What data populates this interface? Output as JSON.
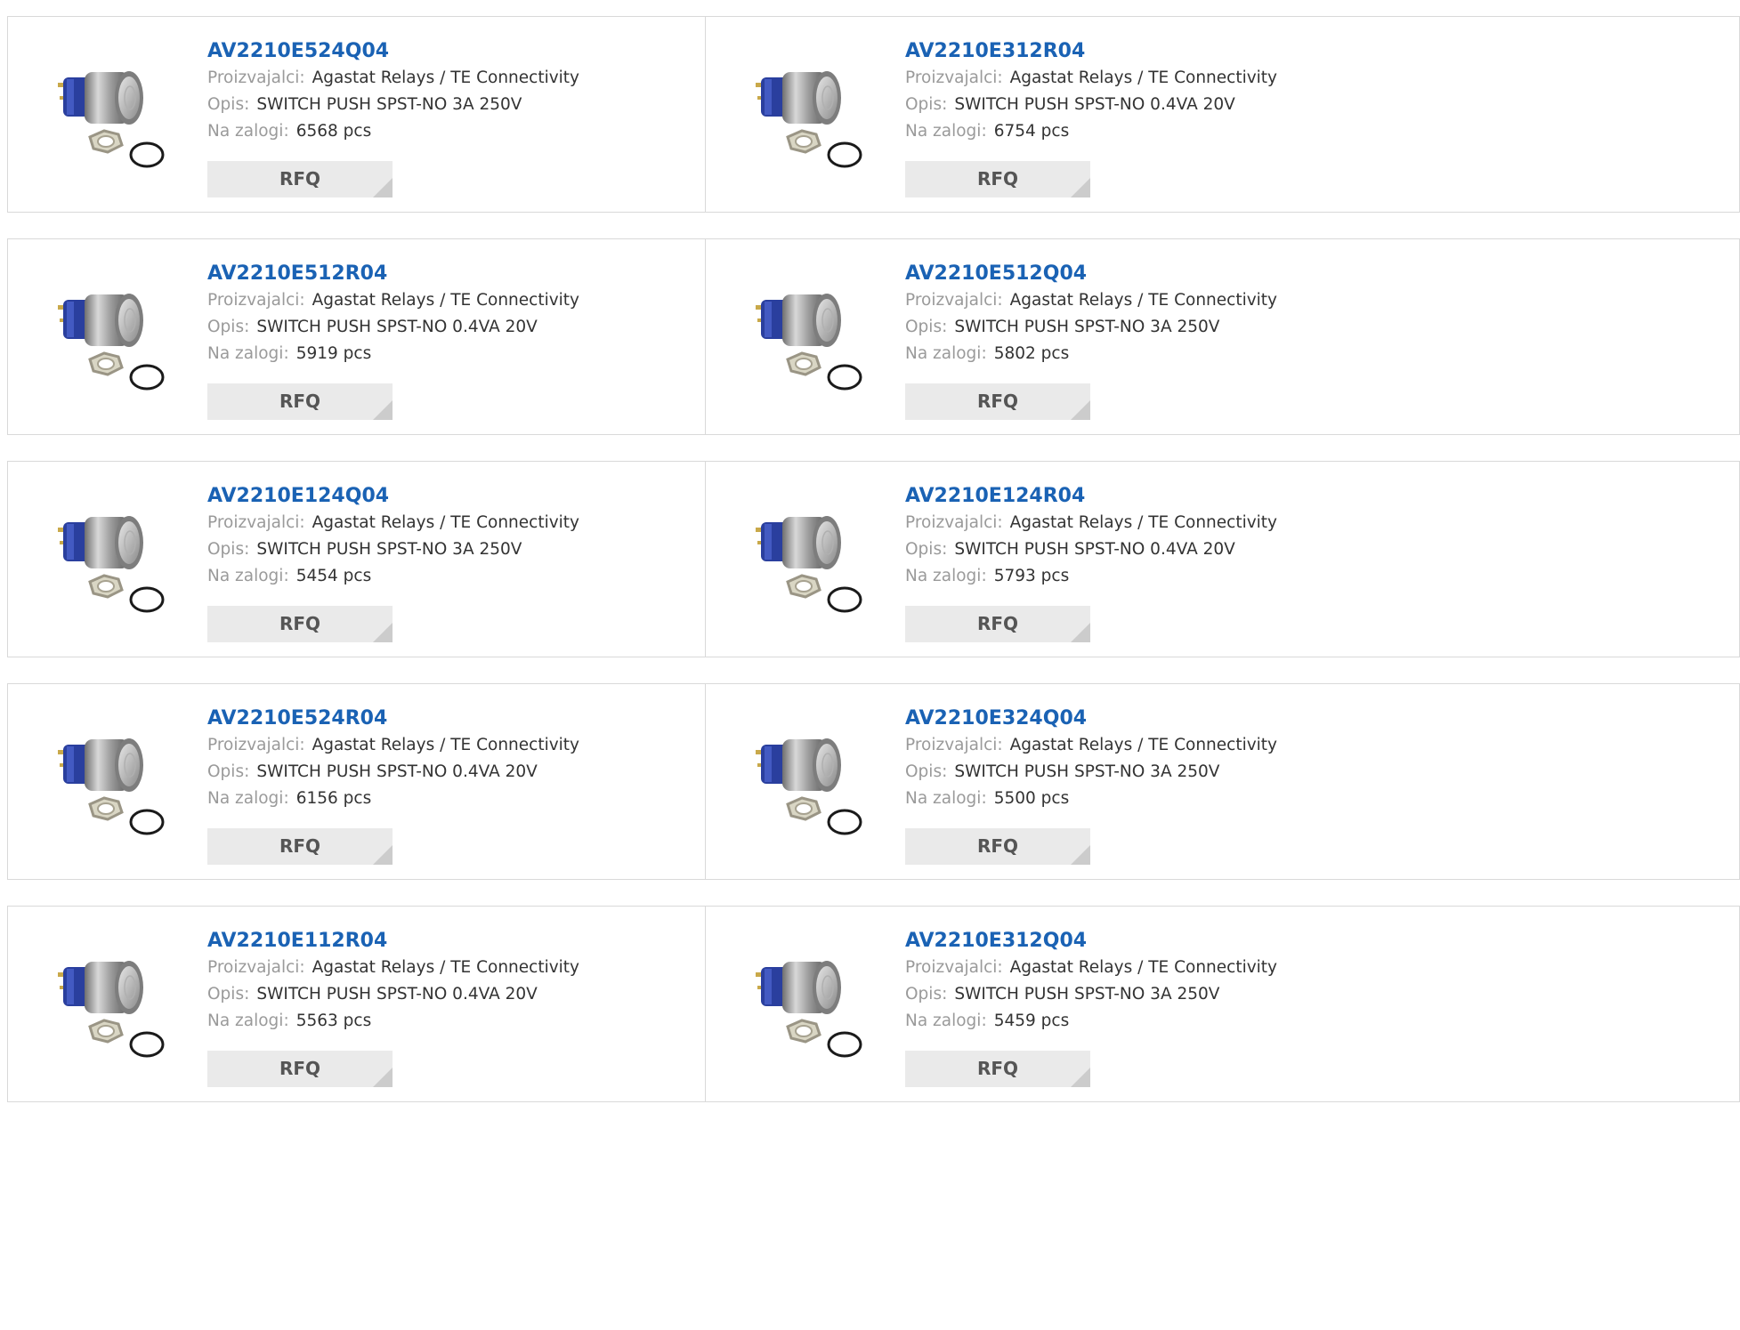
{
  "labels": {
    "manufacturer": "Proizvajalci:",
    "description": "Opis:",
    "stock": "Na zalogi:",
    "rfq_button": "RFQ"
  },
  "colors": {
    "part_link": "#1a62b4",
    "label_gray": "#9a9a9a",
    "value_text": "#333333",
    "button_bg": "#eaeaea",
    "button_text": "#555555",
    "border": "#d9d9d9"
  },
  "image_icon": "push-button-switch-photo",
  "products": [
    {
      "part": "AV2210E524Q04",
      "manufacturer": "Agastat Relays / TE Connectivity",
      "description": "SWITCH PUSH SPST-NO 3A 250V",
      "stock": "6568 pcs",
      "rfq": "RFQ"
    },
    {
      "part": "AV2210E312R04",
      "manufacturer": "Agastat Relays / TE Connectivity",
      "description": "SWITCH PUSH SPST-NO 0.4VA 20V",
      "stock": "6754 pcs",
      "rfq": "RFQ"
    },
    {
      "part": "AV2210E512R04",
      "manufacturer": "Agastat Relays / TE Connectivity",
      "description": "SWITCH PUSH SPST-NO 0.4VA 20V",
      "stock": "5919 pcs",
      "rfq": "RFQ"
    },
    {
      "part": "AV2210E512Q04",
      "manufacturer": "Agastat Relays / TE Connectivity",
      "description": "SWITCH PUSH SPST-NO 3A 250V",
      "stock": "5802 pcs",
      "rfq": "RFQ"
    },
    {
      "part": "AV2210E124Q04",
      "manufacturer": "Agastat Relays / TE Connectivity",
      "description": "SWITCH PUSH SPST-NO 3A 250V",
      "stock": "5454 pcs",
      "rfq": "RFQ"
    },
    {
      "part": "AV2210E124R04",
      "manufacturer": "Agastat Relays / TE Connectivity",
      "description": "SWITCH PUSH SPST-NO 0.4VA 20V",
      "stock": "5793 pcs",
      "rfq": "RFQ"
    },
    {
      "part": "AV2210E524R04",
      "manufacturer": "Agastat Relays / TE Connectivity",
      "description": "SWITCH PUSH SPST-NO 0.4VA 20V",
      "stock": "6156 pcs",
      "rfq": "RFQ"
    },
    {
      "part": "AV2210E324Q04",
      "manufacturer": "Agastat Relays / TE Connectivity",
      "description": "SWITCH PUSH SPST-NO 3A 250V",
      "stock": "5500 pcs",
      "rfq": "RFQ"
    },
    {
      "part": "AV2210E112R04",
      "manufacturer": "Agastat Relays / TE Connectivity",
      "description": "SWITCH PUSH SPST-NO 0.4VA 20V",
      "stock": "5563 pcs",
      "rfq": "RFQ"
    },
    {
      "part": "AV2210E312Q04",
      "manufacturer": "Agastat Relays / TE Connectivity",
      "description": "SWITCH PUSH SPST-NO 3A 250V",
      "stock": "5459 pcs",
      "rfq": "RFQ"
    }
  ]
}
